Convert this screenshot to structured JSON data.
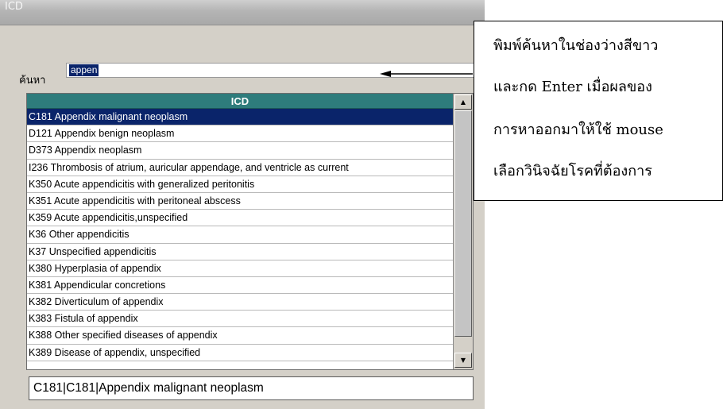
{
  "window": {
    "title": "ICD"
  },
  "search": {
    "label": "ค้นหา",
    "value": "appen"
  },
  "list": {
    "header": "ICD",
    "selected_index": 0,
    "items": [
      "C181 Appendix malignant neoplasm",
      "D121 Appendix benign neoplasm",
      "D373 Appendix neoplasm",
      "I236 Thrombosis of atrium, auricular appendage, and ventricle as current",
      "K350 Acute appendicitis with generalized peritonitis",
      "K351 Acute appendicitis with peritoneal abscess",
      "K359 Acute appendicitis,unspecified",
      "K36 Other appendicitis",
      "K37 Unspecified appendicitis",
      "K380 Hyperplasia of appendix",
      "K381 Appendicular concretions",
      "K382 Diverticulum of appendix",
      "K383 Fistula of appendix",
      "K388 Other specified diseases of appendix",
      "K389 Disease of appendix, unspecified"
    ]
  },
  "result": {
    "value": "C181|C181|Appendix malignant neoplasm"
  },
  "callout": {
    "lines": [
      "พิมพ์ค้นหาในช่องว่างสีขาว",
      "และกด Enter เมื่อผลของ",
      "การหาออกมาให้ใช้ mouse",
      "เลือกวินิจฉัยโรคที่ต้องการ"
    ]
  },
  "colors": {
    "header_bg": "#2e7c7c",
    "selection_bg": "#0a246a",
    "window_bg": "#d4d0c8"
  }
}
